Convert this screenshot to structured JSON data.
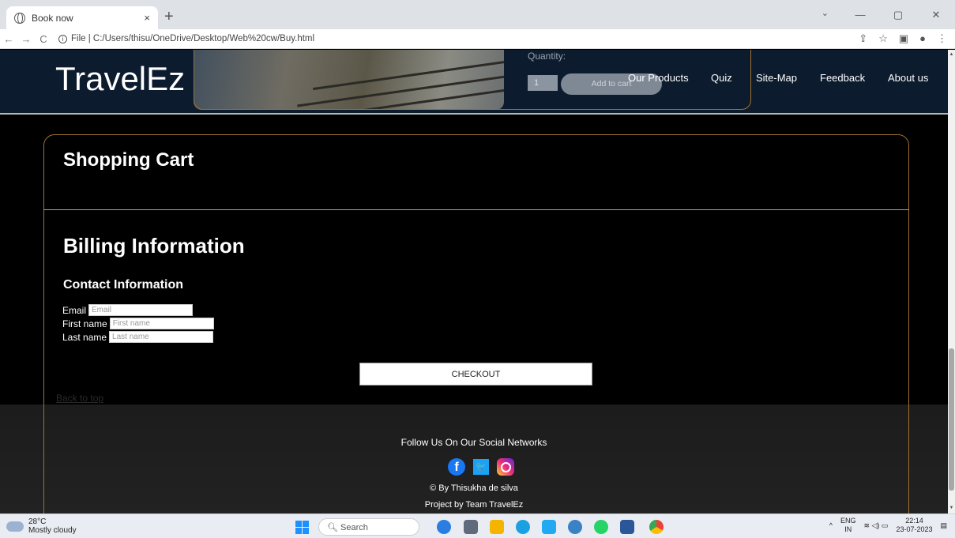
{
  "browser": {
    "tab_title": "Book now",
    "tab_close": "×",
    "new_tab": "+",
    "address_prefix": "File |",
    "address": "C:/Users/thisu/OneDrive/Desktop/Web%20cw/Buy.html"
  },
  "header": {
    "logo": "TravelEz",
    "quantity_label": "Quantity:",
    "quantity_value": "1",
    "add_to_cart": "Add to cart",
    "nav": [
      "Our Products",
      "Quiz",
      "Site-Map",
      "Feedback",
      "About us"
    ]
  },
  "cart": {
    "title": "Shopping Cart"
  },
  "billing": {
    "title": "Billing Information",
    "contact_title": "Contact Information",
    "email_label": "Email",
    "email_placeholder": "Email",
    "first_label": "First name",
    "first_placeholder": "First name",
    "last_label": "Last name",
    "last_placeholder": "Last name",
    "checkout": "CHECKOUT",
    "back_to_top": "Back to top"
  },
  "footer": {
    "follow": "Follow Us On Our Social Networks",
    "copyright": "© By Thisukha de silva",
    "project": "Project by Team TravelEz"
  },
  "taskbar": {
    "temp": "28°C",
    "weather": "Mostly cloudy",
    "search": "Search",
    "lang_top": "ENG",
    "lang_bottom": "IN",
    "time": "22:14",
    "date": "23-07-2023"
  }
}
